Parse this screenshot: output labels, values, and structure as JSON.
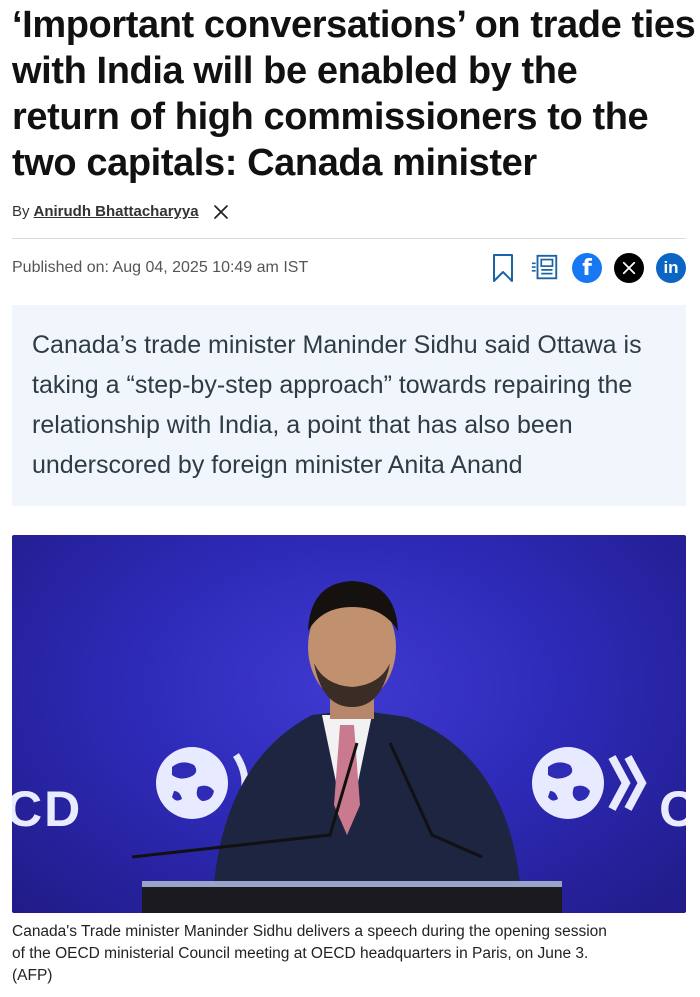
{
  "article": {
    "headline_lines": [
      "‘Important conversations’ on trade ties",
      "with India will be enabled by the",
      "return of high commissioners to the",
      "two capitals: Canada minister"
    ],
    "byline_prefix": "By",
    "author": "Anirudh Bhattacharyya",
    "published": "Published on: Aug 04, 2025 10:49 am IST",
    "summary_lines": [
      "Canada’s trade minister Maninder Sidhu said Ottawa is",
      "taking a “step-by-step approach” towards repairing the",
      "relationship with India, a point that has also been",
      "underscored by foreign minister Anita Anand"
    ],
    "image": {
      "backdrop_left_text": "CD",
      "backdrop_right_text": "O"
    },
    "caption_lines": [
      "Canada's Trade minister Maninder Sidhu delivers a speech during the opening session",
      "of the OECD ministerial Council meeting at OECD headquarters in Paris, on June 3.",
      "(AFP)"
    ]
  },
  "share": {
    "icons": [
      "bookmark-icon",
      "news-feed-icon",
      "facebook-icon",
      "x-icon",
      "linkedin-icon"
    ],
    "facebook_glyph": "f",
    "linkedin_glyph": "in"
  },
  "colors": {
    "facebook": "#1877f2",
    "linkedin": "#0a66c2",
    "summary_bg": "#f0f6fb",
    "stage_blue": "#2e2ab8"
  }
}
